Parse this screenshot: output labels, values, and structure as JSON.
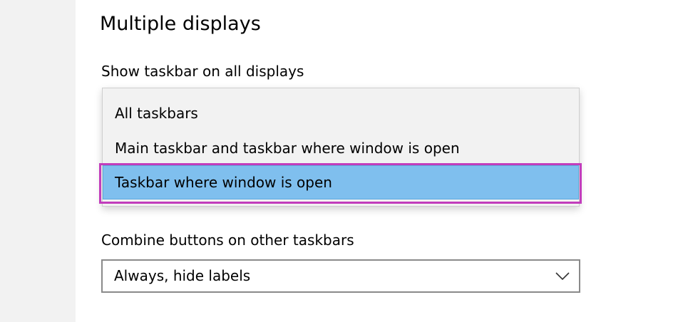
{
  "section": {
    "title": "Multiple displays"
  },
  "show_taskbar": {
    "label": "Show taskbar on all displays",
    "options": [
      "All taskbars",
      "Main taskbar and taskbar where window is open",
      "Taskbar where window is open"
    ],
    "selected_index": 2
  },
  "combine_buttons": {
    "label": "Combine buttons on other taskbars",
    "value": "Always, hide labels",
    "icon": "chevron-down-icon"
  },
  "colors": {
    "selected_option_bg": "#7fbfee",
    "highlight_outline": "#c23dbc",
    "sidebar_bg": "#f2f2f2"
  }
}
